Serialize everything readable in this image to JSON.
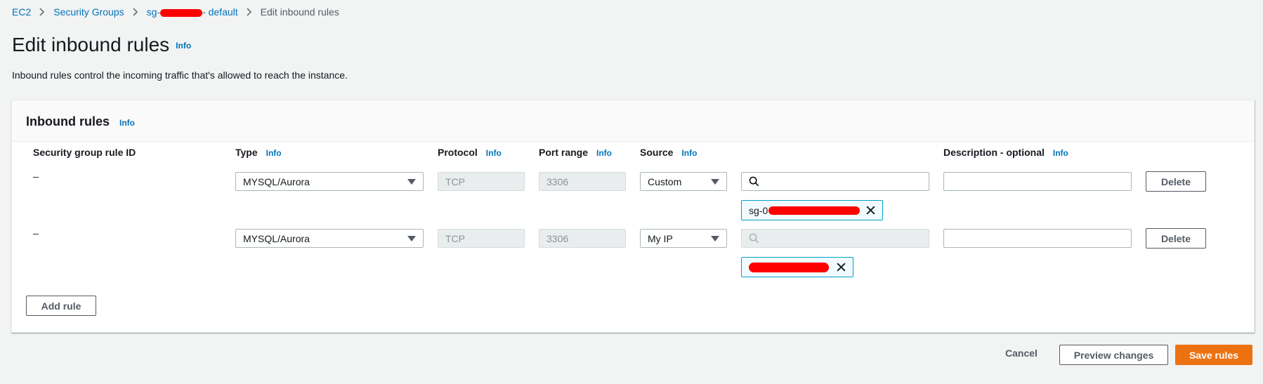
{
  "breadcrumb": {
    "items": [
      "EC2",
      "Security Groups",
      "sg-",
      "- default"
    ],
    "current": "Edit inbound rules"
  },
  "page": {
    "title": "Edit inbound rules",
    "title_info": "Info",
    "description": "Inbound rules control the incoming traffic that's allowed to reach the instance."
  },
  "panel": {
    "title": "Inbound rules",
    "info": "Info",
    "columns": {
      "rule_id": "Security group rule ID",
      "type": "Type",
      "protocol": "Protocol",
      "port_range": "Port range",
      "source": "Source",
      "description": "Description - optional",
      "info": "Info"
    },
    "rows": [
      {
        "rule_id": "–",
        "type": "MYSQL/Aurora",
        "protocol": "TCP",
        "port_range": "3306",
        "source": "Custom",
        "token": "sg-0",
        "delete": "Delete"
      },
      {
        "rule_id": "–",
        "type": "MYSQL/Aurora",
        "protocol": "TCP",
        "port_range": "3306",
        "source": "My IP",
        "token": "",
        "delete": "Delete"
      }
    ],
    "add_rule": "Add rule"
  },
  "footer": {
    "cancel": "Cancel",
    "preview": "Preview changes",
    "save": "Save rules"
  },
  "colors": {
    "link": "#0073bb",
    "primary": "#ec7211",
    "token_border": "#00a1c9",
    "redaction": "#ff0000"
  }
}
